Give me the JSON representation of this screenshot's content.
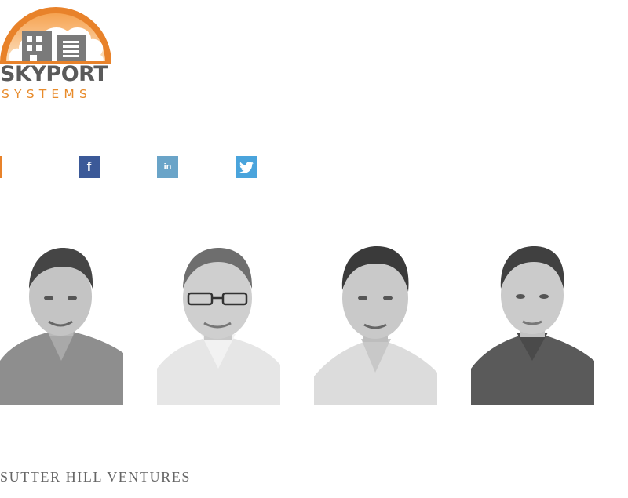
{
  "logo": {
    "line1": "SKYPORT",
    "line2": "SYSTEMS",
    "accent_color": "#e88b2b",
    "text_color": "#5a5a5a"
  },
  "social": {
    "facebook_glyph": "f",
    "linkedin_glyph": "in",
    "twitter_icon": "bird-icon",
    "accent_color": "#e8822a"
  },
  "team": {
    "portraits": [
      "portrait-1",
      "portrait-2",
      "portrait-3",
      "portrait-4"
    ]
  },
  "footer": {
    "investor": "SUTTER HILL VENTURES"
  }
}
